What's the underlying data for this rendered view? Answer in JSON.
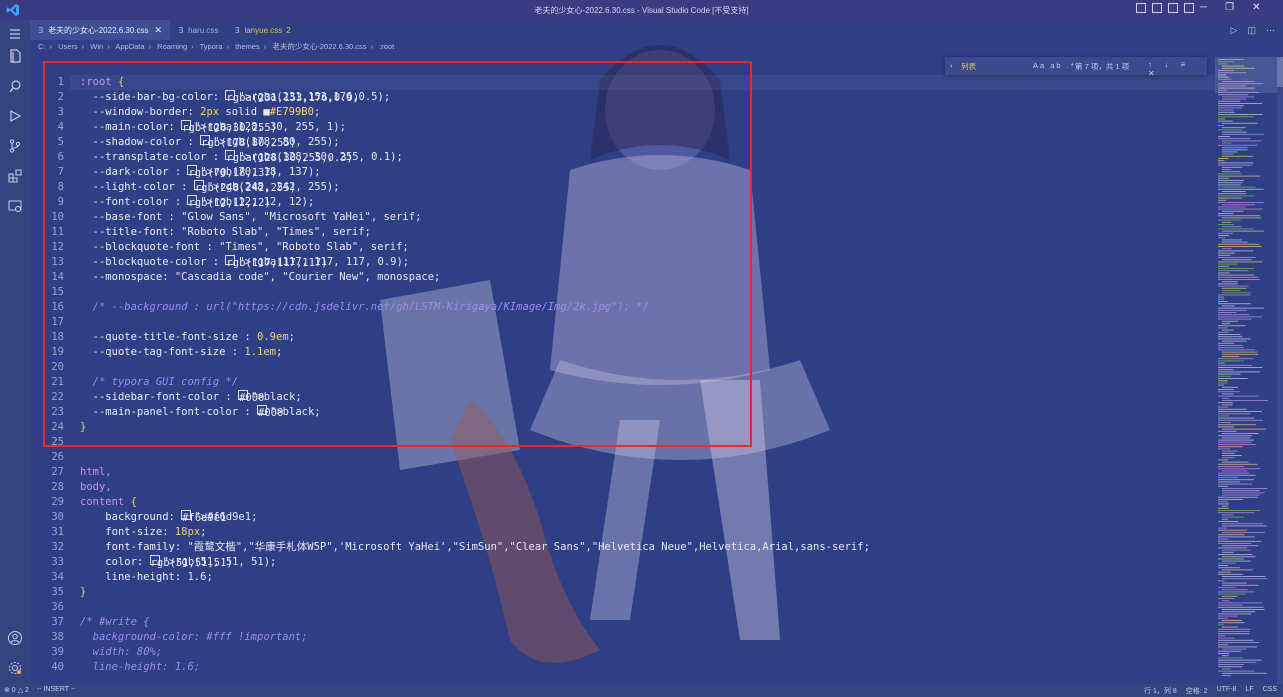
{
  "window": {
    "title": "老夫的少女心-2022.6.30.css - Visual Studio Code [不受支持]",
    "controls": [
      "─",
      "❐",
      "✕"
    ]
  },
  "tabs": [
    {
      "label": "老夫的少女心-2022.6.30.css",
      "active": true,
      "close": "✕"
    },
    {
      "label": "haru.css",
      "active": false
    },
    {
      "label": "lanyue.css",
      "active": false,
      "badge": "2"
    }
  ],
  "breadcrumb": [
    "C:",
    "Users",
    "Win",
    "AppData",
    "Roaming",
    "Typora",
    "themes",
    "老夫的少女心-2022.6.30.css",
    ":root"
  ],
  "find": {
    "query": "列表",
    "options": "Aa ab .*",
    "result": "第 7 项，共 1 项",
    "nav": "↑ ↓ ≡ ✕"
  },
  "editor": {
    "lines": [
      {
        "n": "1",
        "t": ":root {"
      },
      {
        "n": "2",
        "t": "  --side-bar-bg-color: ■rgba(231,153,176,0.5);"
      },
      {
        "n": "3",
        "t": "  --window-border: 2px solid ■#E799B0;"
      },
      {
        "n": "4",
        "t": "  --main-color: ■rgba(128, 30, 255, 1);"
      },
      {
        "n": "5",
        "t": "  --shadow-color : ■rgb(178, 80, 255);"
      },
      {
        "n": "6",
        "t": "  --transplate-color : □rgba(128, 30, 255, 0.1);"
      },
      {
        "n": "7",
        "t": "  --dark-color : □rgb(70, 18, 137);"
      },
      {
        "n": "8",
        "t": "  --light-color : ■rgb(248, 242, 255);"
      },
      {
        "n": "9",
        "t": "  --font-color : □rgb(12, 12, 12);"
      },
      {
        "n": "10",
        "t": "  --base-font : \"Glow Sans\", \"Microsoft YaHei\", serif;"
      },
      {
        "n": "11",
        "t": "  --title-font: \"Roboto Slab\", \"Times\", serif;"
      },
      {
        "n": "12",
        "t": "  --blockquote-font : \"Times\", \"Roboto Slab\", serif;"
      },
      {
        "n": "13",
        "t": "  --blockquote-color : ■rgba(117, 117, 117, 0.9);"
      },
      {
        "n": "14",
        "t": "  --monospace: \"Cascadia code\", \"Courier New\", monospace;"
      },
      {
        "n": "15",
        "t": ""
      },
      {
        "n": "16",
        "t": "  /* --background : url(\"https://cdn.jsdelivr.net/gh/LSTM-Kirigaya/KImage/Img/2k.jpg\"); */"
      },
      {
        "n": "17",
        "t": ""
      },
      {
        "n": "18",
        "t": "  --quote-title-font-size : 0.9em;"
      },
      {
        "n": "19",
        "t": "  --quote-tag-font-size : 1.1em;"
      },
      {
        "n": "20",
        "t": ""
      },
      {
        "n": "21",
        "t": "  /* typora GUI config */"
      },
      {
        "n": "22",
        "t": "  --sidebar-font-color : □black;"
      },
      {
        "n": "23",
        "t": "  --main-panel-font-color : □black;"
      },
      {
        "n": "24",
        "t": "}"
      },
      {
        "n": "25",
        "t": ""
      },
      {
        "n": "26",
        "t": ""
      },
      {
        "n": "27",
        "t": "html,"
      },
      {
        "n": "28",
        "t": "body,"
      },
      {
        "n": "29",
        "t": "content {"
      },
      {
        "n": "30",
        "t": "    background: ■#f6d9e1;"
      },
      {
        "n": "31",
        "t": "    font-size: 18px;"
      },
      {
        "n": "32",
        "t": "    font-family: \"霞鹜文楷\",\"华康手札体W5P\",'Microsoft YaHei',\"SimSun\",\"Clear Sans\",\"Helvetica Neue\",Helvetica,Arial,sans-serif;"
      },
      {
        "n": "33",
        "t": "    color: □rgb(51, 51, 51);"
      },
      {
        "n": "34",
        "t": "    line-height: 1.6;"
      },
      {
        "n": "35",
        "t": "}"
      },
      {
        "n": "36",
        "t": ""
      },
      {
        "n": "37",
        "t": "/* #write {"
      },
      {
        "n": "38",
        "t": "  background-color: #fff !important;"
      },
      {
        "n": "39",
        "t": "  width: 80%;"
      },
      {
        "n": "40",
        "t": "  line-height: 1.6;"
      }
    ]
  },
  "status": {
    "left": [
      "⊗ 0 △ 2",
      "-- INSERT --"
    ],
    "right": [
      "行 1，列 8",
      "空格: 2",
      "UTF-8",
      "LF",
      "CSS"
    ]
  },
  "colors": {
    "editor_bg": "#2e3f86",
    "highlight_box": "#e02a34",
    "selector": "#c792ea",
    "comment": "#9d8bf0"
  }
}
